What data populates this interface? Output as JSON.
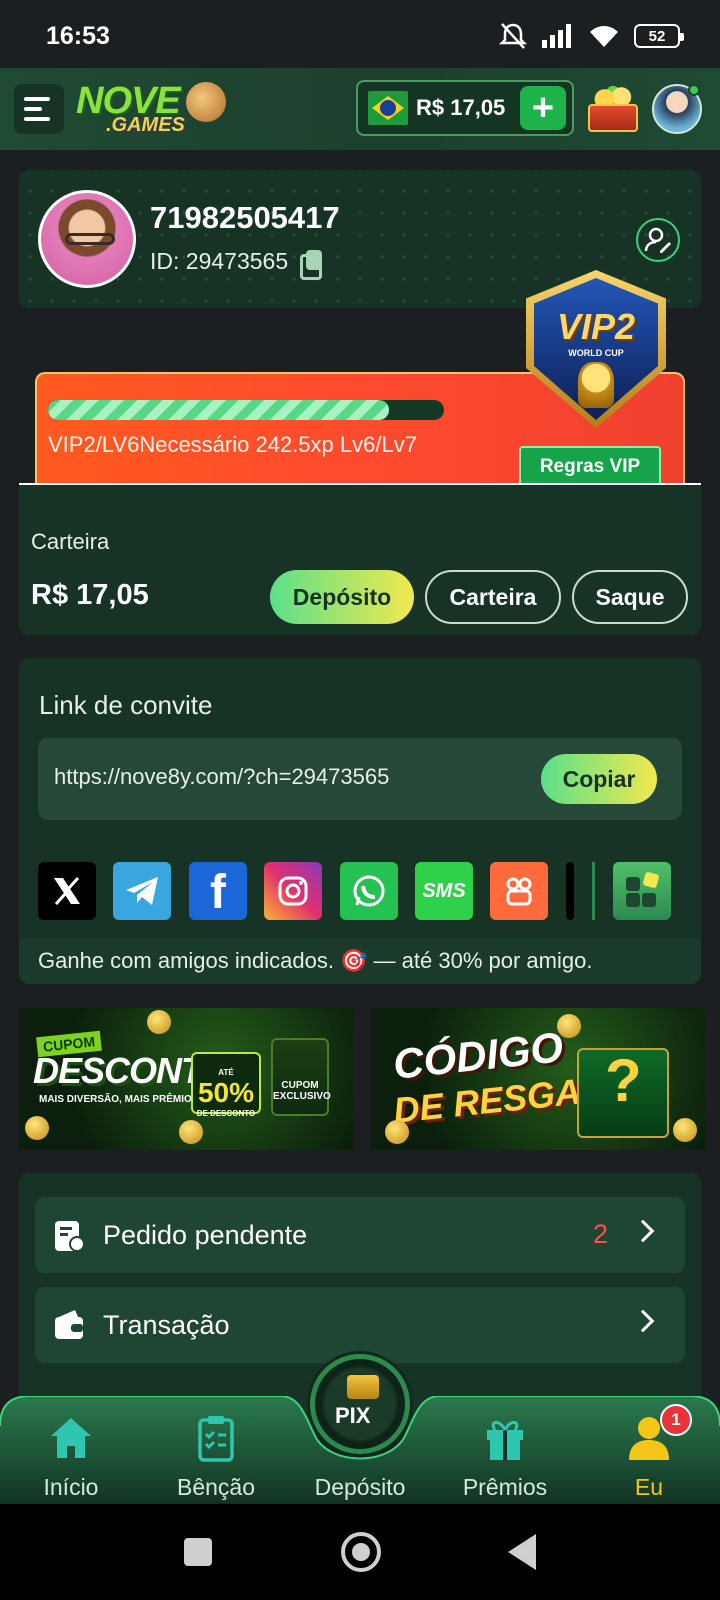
{
  "status_bar": {
    "time": "16:53",
    "battery": "52"
  },
  "header": {
    "logo_top": "NOVE",
    "logo_bottom": ".GAMES",
    "balance": "R$ 17,05",
    "plus": "+"
  },
  "profile": {
    "username": "71982505417",
    "id_label": "ID: 29473565"
  },
  "vip": {
    "badge_label": "VIP2",
    "badge_sub": "WORLD CUP",
    "progress": 0.86,
    "progress_text": "VIP2/LV6Necessário 242.5xp Lv6/Lv7",
    "rules_button": "Regras VIP"
  },
  "wallet": {
    "title": "Carteira",
    "amount": "R$ 17,05",
    "deposit_button": "Depósito",
    "wallet_button": "Carteira",
    "withdraw_button": "Saque"
  },
  "invite": {
    "title": "Link de convite",
    "url": "https://nove8y.com/?ch=29473565",
    "copy_button": "Copiar",
    "share_sms": "SMS",
    "footer_text": "Ganhe com amigos indicados. 🎯 — até 30% por amigo."
  },
  "banners": {
    "coupon": {
      "tag": "CUPOM",
      "title": "DESCONTO",
      "tagline": "MAIS DIVERSÃO, MAIS PRÊMIOS!",
      "up_to": "ATÉ",
      "percent": "50%",
      "percent_sub": "DE DESCONTO",
      "ticket": "CUPOM EXCLUSIVO"
    },
    "code": {
      "line1": "CÓDIGO",
      "line2": "DE RESGATE"
    }
  },
  "menu": [
    {
      "label": "Pedido pendente",
      "count": "2"
    },
    {
      "label": "Transação",
      "count": ""
    }
  ],
  "bottom_nav": {
    "items": [
      "Início",
      "Bênção",
      "Depósito",
      "Prêmios",
      "Eu"
    ],
    "active": "Eu",
    "notification_count": "1",
    "pix_label": "PIX"
  },
  "colors": {
    "accent_green": "#1db34a",
    "card_bg": "#173326",
    "active_nav": "#f5c518",
    "vip_orange": "#ff5a1f"
  }
}
